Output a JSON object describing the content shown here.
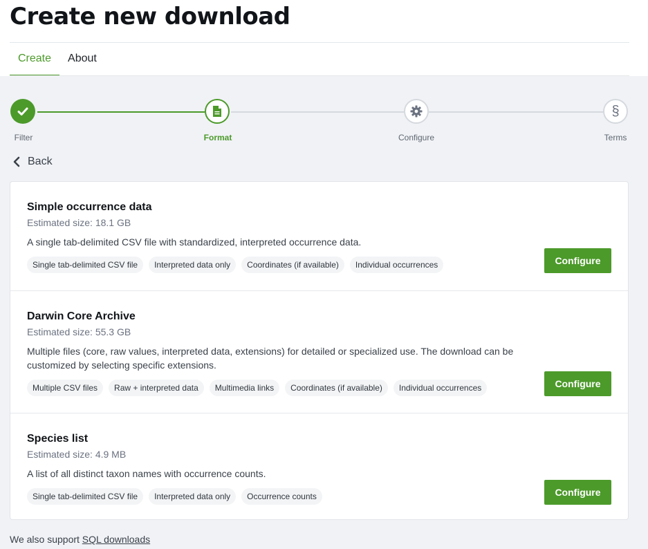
{
  "page": {
    "title": "Create new download"
  },
  "tabs": [
    {
      "label": "Create",
      "active": true
    },
    {
      "label": "About",
      "active": false
    }
  ],
  "stepper": {
    "steps": [
      {
        "label": "Filter",
        "state": "done",
        "icon": "check-icon"
      },
      {
        "label": "Format",
        "state": "active",
        "icon": "document-icon"
      },
      {
        "label": "Configure",
        "state": "pending",
        "icon": "gear-icon"
      },
      {
        "label": "Terms",
        "state": "pending",
        "icon": "section-icon",
        "symbol": "§"
      }
    ]
  },
  "back": {
    "label": "Back"
  },
  "options": [
    {
      "title": "Simple occurrence data",
      "size": "Estimated size: 18.1 GB",
      "description": "A single tab-delimited CSV file with standardized, interpreted occurrence data.",
      "tags": [
        "Single tab-delimited CSV file",
        "Interpreted data only",
        "Coordinates (if available)",
        "Individual occurrences"
      ],
      "button": "Configure"
    },
    {
      "title": "Darwin Core Archive",
      "size": "Estimated size: 55.3 GB",
      "description": "Multiple files (core, raw values, interpreted data, extensions) for detailed or specialized use. The download can be customized by selecting specific extensions.",
      "tags": [
        "Multiple CSV files",
        "Raw + interpreted data",
        "Multimedia links",
        "Coordinates (if available)",
        "Individual occurrences"
      ],
      "button": "Configure"
    },
    {
      "title": "Species list",
      "size": "Estimated size: 4.9 MB",
      "description": "A list of all distinct taxon names with occurrence counts.",
      "tags": [
        "Single tab-delimited CSV file",
        "Interpreted data only",
        "Occurrence counts"
      ],
      "button": "Configure"
    }
  ],
  "footer": {
    "text": "We also support ",
    "link": "SQL downloads"
  },
  "colors": {
    "accent": "#4c9a2a",
    "background": "#f0f2f6",
    "inactive": "#d5d9de"
  }
}
